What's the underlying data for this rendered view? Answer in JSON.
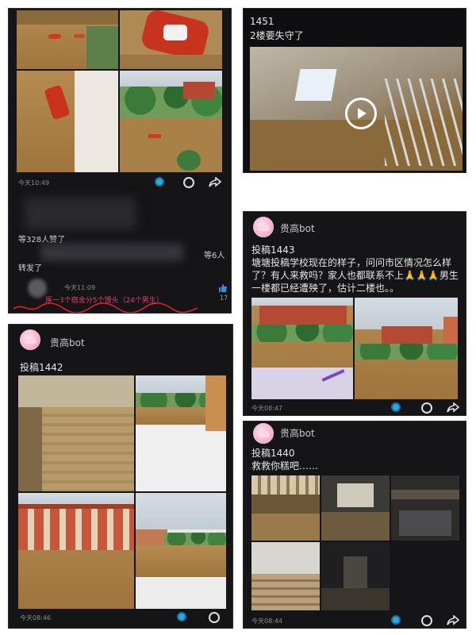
{
  "panel_a": {
    "timestamp": "今天10:49",
    "like_count_text": "等328人赞了",
    "like_names_text": "等6人",
    "forwarded_label": "转发了",
    "comment_time": "今天11:09",
    "comment_text": "厚一3个宿舍分5个馒头（24个男生）",
    "comment_like_count": "17"
  },
  "panel_b": {
    "post_id": "1451",
    "caption": "2楼要失守了"
  },
  "panel_c": {
    "bot_name": "贵高bot",
    "post_title": "投稿1443",
    "post_body": "塘塘投稿学校现在的样子，问问市区情况怎么样了？有人来救吗？家人也都联系不上🙏🙏🙏男生一楼都已经遭殃了，估计二楼也。。",
    "timestamp": "今天08:47"
  },
  "panel_d": {
    "bot_name": "贵高bot",
    "post_title": "投稿1442",
    "timestamp": "今天08:46"
  },
  "panel_e": {
    "bot_name": "贵高bot",
    "post_title": "投稿1440",
    "post_body": "救救你糕吧……",
    "timestamp": "今天08:44"
  },
  "icons": {
    "dot_color": "#2aa8e0",
    "annotation_color": "#e0202a"
  }
}
